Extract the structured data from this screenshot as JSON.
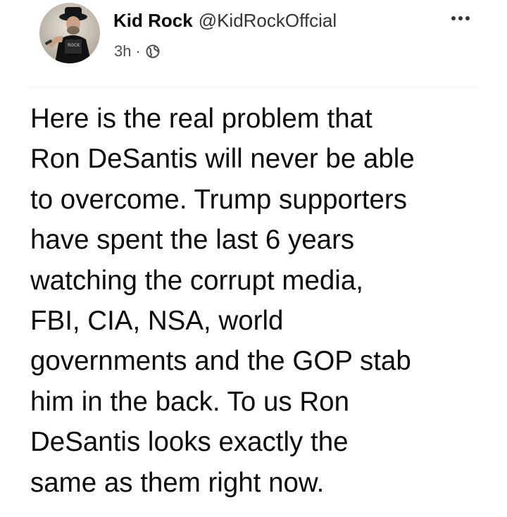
{
  "post": {
    "author": {
      "display_name": "Kid Rock",
      "handle": "@KidRockOffcial",
      "avatar": "avatar-photo"
    },
    "meta": {
      "timestamp": "3h",
      "separator": "·",
      "audience_icon": "globe-icon"
    },
    "more_options_icon": "more-options-icon",
    "body_lines": [
      "Here is the real problem that",
      "Ron DeSantis will never be able",
      "to overcome. Trump supporters",
      "have spent the last 6 years",
      "watching the corrupt media,",
      "FBI, CIA, NSA, world",
      "governments and the GOP stab",
      "him in the back. To us Ron",
      "DeSantis looks exactly the",
      "same as them right now."
    ]
  },
  "colors": {
    "background": "#ffffff",
    "text": "#050505",
    "secondary_text": "#4b4f56"
  }
}
